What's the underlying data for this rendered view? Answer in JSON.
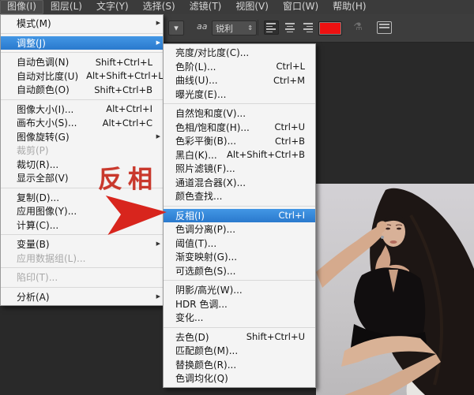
{
  "menubar": {
    "items": [
      {
        "label": "图像(I)",
        "active": true
      },
      {
        "label": "图层(L)",
        "active": false
      },
      {
        "label": "文字(Y)",
        "active": false
      },
      {
        "label": "选择(S)",
        "active": false
      },
      {
        "label": "滤镜(T)",
        "active": false
      },
      {
        "label": "视图(V)",
        "active": false
      },
      {
        "label": "窗口(W)",
        "active": false
      },
      {
        "label": "帮助(H)",
        "active": false
      }
    ]
  },
  "toolbar": {
    "preset_dropdown_icon": "▾",
    "antialias_label": "aa",
    "sharpness_value": "锐利",
    "sharpness_spinner_icon": "⇕",
    "align_icons": [
      "align-left-icon",
      "align-center-icon",
      "align-right-icon"
    ],
    "text_color_swatch": "#ee1111",
    "warp_text_icon": "warp-text-icon",
    "toggle_panels_icon": "toggle-panels-icon"
  },
  "image_menu": {
    "items": [
      {
        "label": "模式(M)",
        "arrow": true
      },
      {
        "separator": true
      },
      {
        "label": "调整(J)",
        "arrow": true,
        "highlighted": true
      },
      {
        "separator": true
      },
      {
        "label": "自动色调(N)",
        "shortcut": "Shift+Ctrl+L"
      },
      {
        "label": "自动对比度(U)",
        "shortcut": "Alt+Shift+Ctrl+L"
      },
      {
        "label": "自动颜色(O)",
        "shortcut": "Shift+Ctrl+B"
      },
      {
        "separator": true
      },
      {
        "label": "图像大小(I)...",
        "shortcut": "Alt+Ctrl+I"
      },
      {
        "label": "画布大小(S)...",
        "shortcut": "Alt+Ctrl+C"
      },
      {
        "label": "图像旋转(G)",
        "arrow": true
      },
      {
        "label": "裁剪(P)",
        "disabled": true
      },
      {
        "label": "裁切(R)..."
      },
      {
        "label": "显示全部(V)"
      },
      {
        "separator": true
      },
      {
        "label": "复制(D)..."
      },
      {
        "label": "应用图像(Y)..."
      },
      {
        "label": "计算(C)..."
      },
      {
        "separator": true
      },
      {
        "label": "变量(B)",
        "arrow": true
      },
      {
        "label": "应用数据组(L)...",
        "disabled": true
      },
      {
        "separator": true
      },
      {
        "label": "陷印(T)...",
        "disabled": true
      },
      {
        "separator": true
      },
      {
        "label": "分析(A)",
        "arrow": true
      }
    ]
  },
  "adjustments_submenu": {
    "items": [
      {
        "label": "亮度/对比度(C)..."
      },
      {
        "label": "色阶(L)...",
        "shortcut": "Ctrl+L"
      },
      {
        "label": "曲线(U)...",
        "shortcut": "Ctrl+M"
      },
      {
        "label": "曝光度(E)..."
      },
      {
        "separator": true
      },
      {
        "label": "自然饱和度(V)..."
      },
      {
        "label": "色相/饱和度(H)...",
        "shortcut": "Ctrl+U"
      },
      {
        "label": "色彩平衡(B)...",
        "shortcut": "Ctrl+B"
      },
      {
        "label": "黑白(K)...",
        "shortcut": "Alt+Shift+Ctrl+B"
      },
      {
        "label": "照片滤镜(F)..."
      },
      {
        "label": "通道混合器(X)..."
      },
      {
        "label": "颜色查找..."
      },
      {
        "separator": true
      },
      {
        "label": "反相(I)",
        "shortcut": "Ctrl+I",
        "highlighted": true
      },
      {
        "label": "色调分离(P)..."
      },
      {
        "label": "阈值(T)..."
      },
      {
        "label": "渐变映射(G)..."
      },
      {
        "label": "可选颜色(S)..."
      },
      {
        "separator": true
      },
      {
        "label": "阴影/高光(W)..."
      },
      {
        "label": "HDR 色调..."
      },
      {
        "label": "变化..."
      },
      {
        "separator": true
      },
      {
        "label": "去色(D)",
        "shortcut": "Shift+Ctrl+U"
      },
      {
        "label": "匹配颜色(M)..."
      },
      {
        "label": "替换颜色(R)..."
      },
      {
        "label": "色调均化(Q)"
      }
    ]
  },
  "annotation": {
    "text": "反相",
    "color": "#c9382c"
  }
}
